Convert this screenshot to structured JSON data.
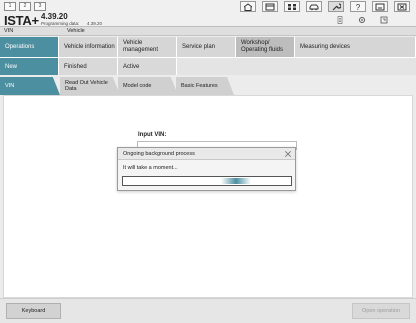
{
  "header": {
    "nums": [
      "1",
      "2",
      "3"
    ],
    "brand": "ISTA+",
    "version": "4.39.20",
    "programming_label": "Programming data:",
    "programming_value": "4.39.20",
    "toolbar_icons": [
      "home-icon",
      "window-icon",
      "tiles-icon",
      "car-icon",
      "wrench-icon",
      "help-icon",
      "minimize-icon",
      "close-icon"
    ],
    "toolbar_icons_row2": [
      "document-icon",
      "settings-icon",
      "expand-icon"
    ]
  },
  "breadcrumb": {
    "left": "VIN",
    "right": "Vehicle"
  },
  "main_tabs": [
    {
      "label": "Operations"
    },
    {
      "label": "Vehicle information"
    },
    {
      "label": "Vehicle management"
    },
    {
      "label": "Service plan"
    },
    {
      "label": "Workshop/ Operating fluids"
    },
    {
      "label": "Measuring devices"
    }
  ],
  "sub_tabs": [
    {
      "label": "New"
    },
    {
      "label": "Finished"
    },
    {
      "label": "Active"
    }
  ],
  "third_tabs": [
    {
      "label": "VIN"
    },
    {
      "label": "Read Out Vehicle Data"
    },
    {
      "label": "Model code"
    },
    {
      "label": "Basic Features"
    }
  ],
  "content": {
    "input_vin_label": "Input VIN:"
  },
  "dialog": {
    "title": "Ongoing background process",
    "message": "It will take a moment..."
  },
  "footer": {
    "keyboard_label": "Keyboard",
    "open_label": "Open operation"
  },
  "colors": {
    "accent": "#4c8fa0"
  }
}
